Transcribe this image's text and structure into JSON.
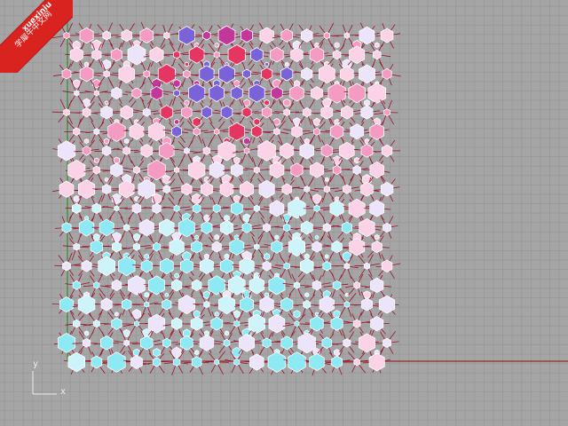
{
  "watermark": {
    "site": "xuexiniu",
    "name": "学犀牛中文网"
  },
  "axes": {
    "x_label": "x",
    "y_label": "y",
    "x_color": "#9c2a2a",
    "y_color": "#2e8b2e"
  },
  "pattern": {
    "cell_stroke": "#9a1030",
    "hex_stroke": "#ffffff",
    "colors": {
      "magenta": "#c2379a",
      "red": "#e53563",
      "violet": "#7a62d8",
      "pink": "#f59ac0",
      "light_pink": "#fbd2e6",
      "lavender": "#ece4fb",
      "cyan": "#8de9f4",
      "pale_cyan": "#cdf4fa"
    }
  }
}
